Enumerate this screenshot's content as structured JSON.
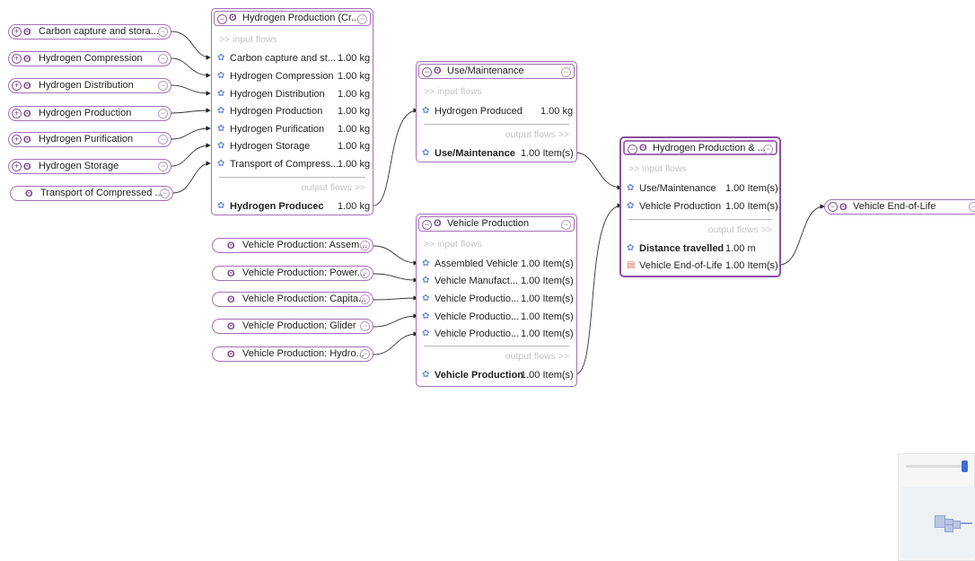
{
  "left_inputs_top": [
    {
      "label": "Carbon capture and stora..."
    },
    {
      "label": "Hydrogen Compression"
    },
    {
      "label": "Hydrogen Distribution"
    },
    {
      "label": "Hydrogen Production"
    },
    {
      "label": "Hydrogen Purification"
    },
    {
      "label": "Hydrogen Storage"
    },
    {
      "label": "Transport of Compressed ..."
    }
  ],
  "left_inputs_bottom": [
    {
      "label": "Vehicle Production: Assem..."
    },
    {
      "label": "Vehicle Production: Power..."
    },
    {
      "label": "Vehicle Production: Capita..."
    },
    {
      "label": "Vehicle Production: Glider"
    },
    {
      "label": "Vehicle Production: Hydro..."
    }
  ],
  "sections": {
    "input_flows": ">> input flows",
    "output_flows": "output flows >>"
  },
  "node_hydrogen_production": {
    "title": "Hydrogen Production (Cr...",
    "inputs": [
      {
        "name": "Carbon capture and st...",
        "value": "1.00 kg"
      },
      {
        "name": "Hydrogen Compression",
        "value": "1.00 kg"
      },
      {
        "name": "Hydrogen Distribution",
        "value": "1.00 kg"
      },
      {
        "name": "Hydrogen Production",
        "value": "1.00 kg"
      },
      {
        "name": "Hydrogen Purification",
        "value": "1.00 kg"
      },
      {
        "name": "Hydrogen Storage",
        "value": "1.00 kg"
      },
      {
        "name": "Transport of Compress...",
        "value": "1.00 kg"
      }
    ],
    "output": {
      "name": "Hydrogen Producec",
      "value": "1.00 kg"
    }
  },
  "node_use_maintenance": {
    "title": "Use/Maintenance",
    "inputs": [
      {
        "name": "Hydrogen Produced",
        "value": "1.00 kg"
      }
    ],
    "output": {
      "name": "Use/Maintenance",
      "value": "1.00 Item(s)"
    }
  },
  "node_vehicle_production": {
    "title": "Vehicle Production",
    "inputs": [
      {
        "name": "Assembled Vehicle",
        "value": "1.00 Item(s)"
      },
      {
        "name": "Vehicle Manufact...",
        "value": "1.00 Item(s)"
      },
      {
        "name": "Vehicle Productio...",
        "value": "1.00 Item(s)"
      },
      {
        "name": "Vehicle Productio...",
        "value": "1.00 Item(s)"
      },
      {
        "name": "Vehicle Productio...",
        "value": "1.00 Item(s)"
      }
    ],
    "output": {
      "name": "Vehicle Production",
      "value": "1.00 Item(s)"
    }
  },
  "node_hydrogen_production_and": {
    "title": "Hydrogen Production & ...",
    "inputs": [
      {
        "name": "Use/Maintenance",
        "value": "1.00 Item(s)"
      },
      {
        "name": "Vehicle Production",
        "value": "1.00 Item(s)"
      }
    ],
    "outputs": [
      {
        "name": "Distance travelled",
        "value": "1.00 m"
      },
      {
        "name": "Vehicle End-of-Life",
        "value": "1.00 Item(s)"
      }
    ]
  },
  "right_output": {
    "label": "Vehicle End-of-Life"
  },
  "icons": {
    "plus": "⊕",
    "minus": "⊖",
    "process": "⊡",
    "flow": "❁",
    "waste": "🗑"
  }
}
